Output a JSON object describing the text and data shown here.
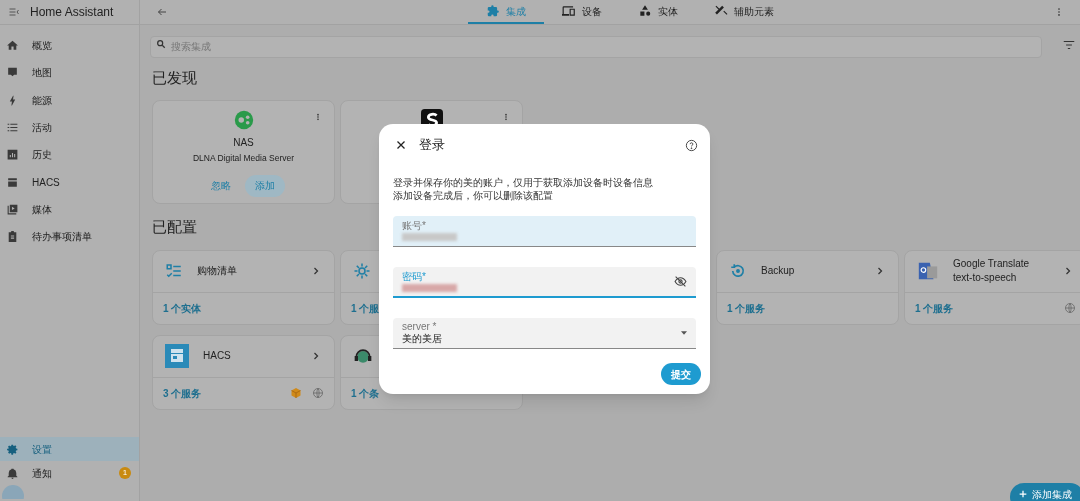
{
  "app_title": "Home Assistant",
  "sidebar": {
    "items": [
      {
        "label": "概览",
        "selected": false
      },
      {
        "label": "地图",
        "selected": false
      },
      {
        "label": "能源",
        "selected": false
      },
      {
        "label": "活动",
        "selected": false
      },
      {
        "label": "历史",
        "selected": false
      },
      {
        "label": "HACS",
        "selected": false
      },
      {
        "label": "媒体",
        "selected": false
      },
      {
        "label": "待办事项清单",
        "selected": false
      }
    ],
    "bottom_items": [
      {
        "label": "设置",
        "selected": true
      },
      {
        "label": "通知",
        "selected": false,
        "badge": "1"
      }
    ]
  },
  "tabs": [
    {
      "label": "集成",
      "selected": true
    },
    {
      "label": "设备",
      "selected": false
    },
    {
      "label": "实体",
      "selected": false
    },
    {
      "label": "辅助元素",
      "selected": false
    }
  ],
  "search": {
    "placeholder": "搜索集成"
  },
  "discovered": {
    "title": "已发现",
    "cards": [
      {
        "name": "NAS",
        "subtitle": "DLNA Digital Media Server",
        "ignore": "忽略",
        "add": "添加",
        "kind": "full"
      },
      {
        "kind": "partly_hidden"
      }
    ]
  },
  "configured": {
    "title": "已配置",
    "cards": [
      {
        "name": "购物清单",
        "footer": "1 个实体"
      },
      {
        "footer": "1 个服"
      },
      {
        "name": "Backup",
        "footer": "1 个服务"
      },
      {
        "name": "Google Translate text-to-speech",
        "footer": "1 个服务",
        "cloud": true
      },
      {
        "name": "HACS",
        "footer": "3 个服务",
        "custom": true,
        "cloud": true
      },
      {
        "footer": "1 个条"
      }
    ]
  },
  "dialog": {
    "title": "登录",
    "description": [
      "登录并保存你的美的账户，仅用于获取添加设备时设备信息",
      "添加设备完成后，你可以删除该配置"
    ],
    "fields": [
      {
        "kind": "text",
        "label": "账号*",
        "focused": false
      },
      {
        "kind": "password",
        "label": "密码*",
        "focused": true
      },
      {
        "kind": "select",
        "label": "server *",
        "value": "美的美居",
        "focused": false
      }
    ],
    "submit": "提交"
  },
  "fab": "添加集成"
}
